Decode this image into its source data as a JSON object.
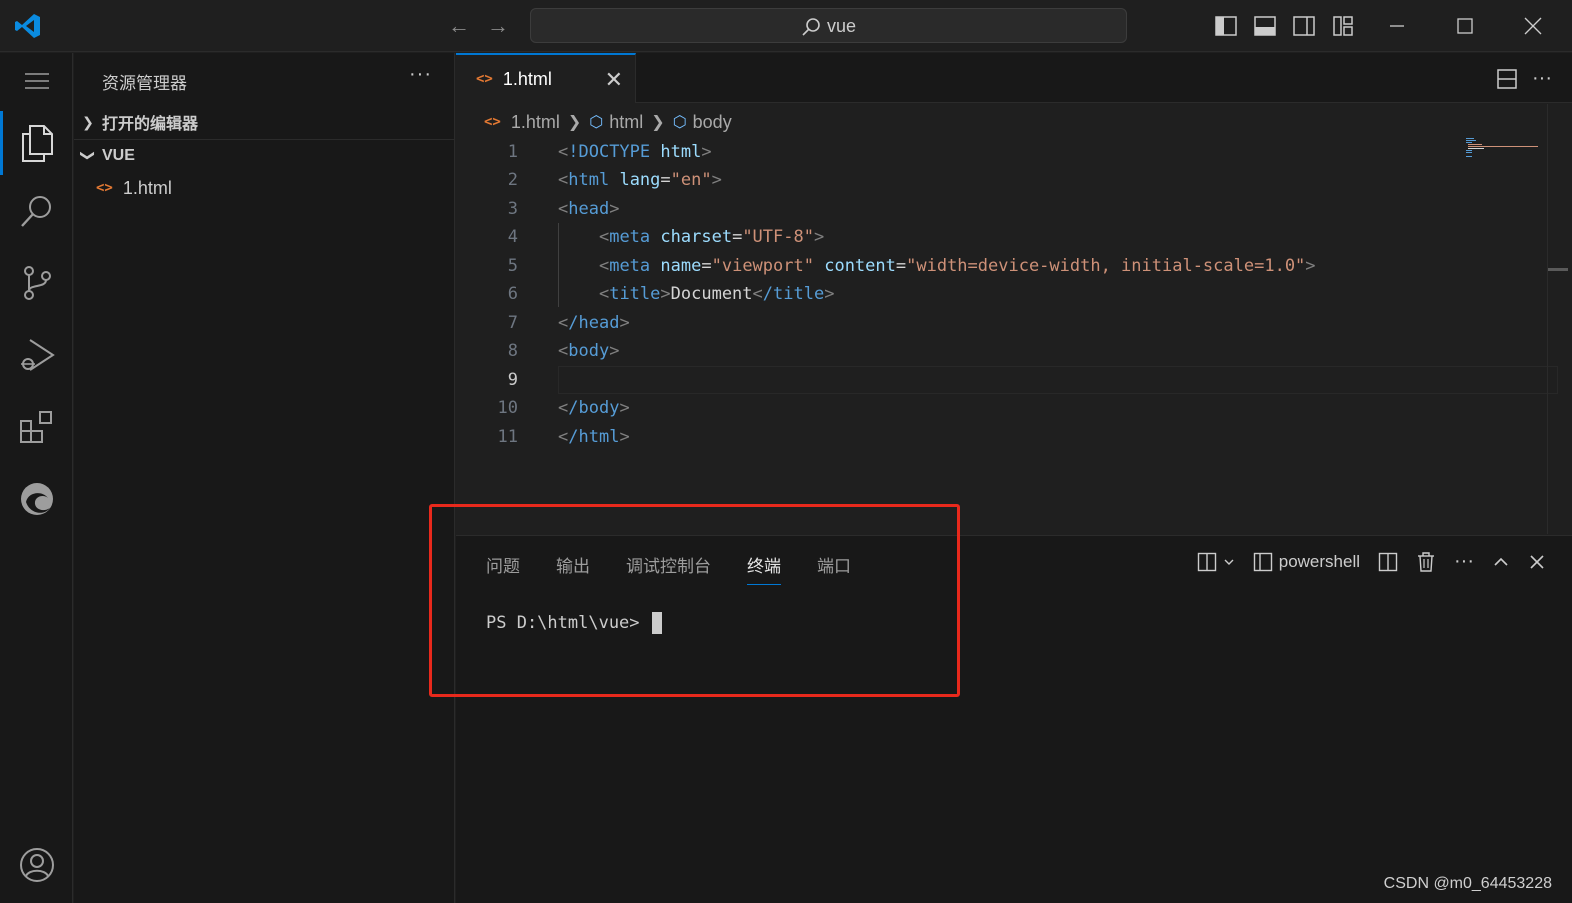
{
  "titlebar": {
    "search_text": "vue",
    "back_glyph": "←",
    "forward_glyph": "→"
  },
  "activitybar": {
    "items": [
      "files-icon",
      "search-icon",
      "source-control-icon",
      "run-debug-icon",
      "extensions-icon",
      "edge-icon"
    ],
    "account": "account-icon",
    "menu": "menu-icon"
  },
  "sidebar": {
    "title": "资源管理器",
    "more": "···",
    "open_editors": "打开的编辑器",
    "folder": "VUE",
    "files": [
      {
        "tag": "<>",
        "name": "1.html"
      }
    ]
  },
  "editor": {
    "tab": {
      "tag": "<>",
      "name": "1.html",
      "close": "✕"
    },
    "more": "···",
    "breadcrumb": {
      "file": "1.html",
      "html": "html",
      "body": "body"
    },
    "active_line": 9,
    "lines": [
      {
        "n": "1"
      },
      {
        "n": "2"
      },
      {
        "n": "3"
      },
      {
        "n": "4"
      },
      {
        "n": "5"
      },
      {
        "n": "6"
      },
      {
        "n": "7"
      },
      {
        "n": "8"
      },
      {
        "n": "9"
      },
      {
        "n": "10"
      },
      {
        "n": "11"
      }
    ],
    "code": {
      "l1_doctype": "!DOCTYPE",
      "l1_html": "html",
      "l2_tag": "html",
      "l2_attr": "lang",
      "l2_val": "\"en\"",
      "l3_tag": "head",
      "l4_tag": "meta",
      "l4_attr": "charset",
      "l4_val": "\"UTF-8\"",
      "l5_tag": "meta",
      "l5_attr1": "name",
      "l5_val1": "\"viewport\"",
      "l5_attr2": "content",
      "l5_val2": "\"width=device-width, initial-scale=1.0\"",
      "l6_tag": "title",
      "l6_text": "Document",
      "l6_close": "/title",
      "l7_close": "/head",
      "l8_tag": "body",
      "l10_close": "/body",
      "l11_close": "/html"
    }
  },
  "panel": {
    "tabs": [
      "问题",
      "输出",
      "调试控制台",
      "终端",
      "端口"
    ],
    "active_tab": "终端",
    "shell": "powershell",
    "more": "···",
    "prompt": "PS D:\\html\\vue>"
  },
  "colors": {
    "accent": "#0078d4",
    "highlight": "#e8291c",
    "html_icon": "#e37933"
  },
  "watermark": "CSDN @m0_64453228"
}
